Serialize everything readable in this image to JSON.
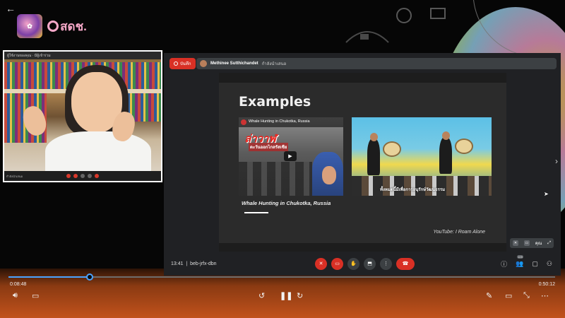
{
  "self_view": {
    "top_text": "ผู้ใช้งานของคุณ · มีผู้เข้าร่วม",
    "name_tag": "กำลังนำเสนอ"
  },
  "meet": {
    "record_label": "บันทึก",
    "presenter_name": "Methinee Sutthichandet",
    "presenter_status": "กำลังนำเสนอ",
    "meeting_time": "13:41",
    "meeting_code": "beb-jrfx-dbn",
    "participant_count": "109",
    "mini_ctrl_label": "คุณ"
  },
  "slide": {
    "title": "Examples",
    "video1_title": "Whale Hunting in Chukotka, Russia",
    "video1_overlay_big": "ล่าวาฬ",
    "video1_overlay_sub": "ตะวันออกไกลรัสเซีย",
    "video2_caption": "ทั้งหมดนี้มีเพื่อการอนุรักษ์วัฒนธรรม",
    "caption": "Whale Hunting in Chukotka, Russia",
    "source": "YouTube: I Roam Alone"
  },
  "player": {
    "elapsed": "0:08:48",
    "remaining": "0:50:12",
    "progress": 0.149
  },
  "icons": {
    "back": "back-arrow-icon",
    "volume": "volume-icon",
    "subtitles": "subtitles-icon",
    "rewind": "rewind-10-icon",
    "pause": "pause-icon",
    "forward": "forward-30-icon",
    "pen": "pen-icon",
    "cast": "cast-icon",
    "fullscreen": "exit-fullscreen-icon",
    "more": "more-icon"
  },
  "colors": {
    "accent": "#4aa3ff",
    "record_red": "#d93025"
  }
}
